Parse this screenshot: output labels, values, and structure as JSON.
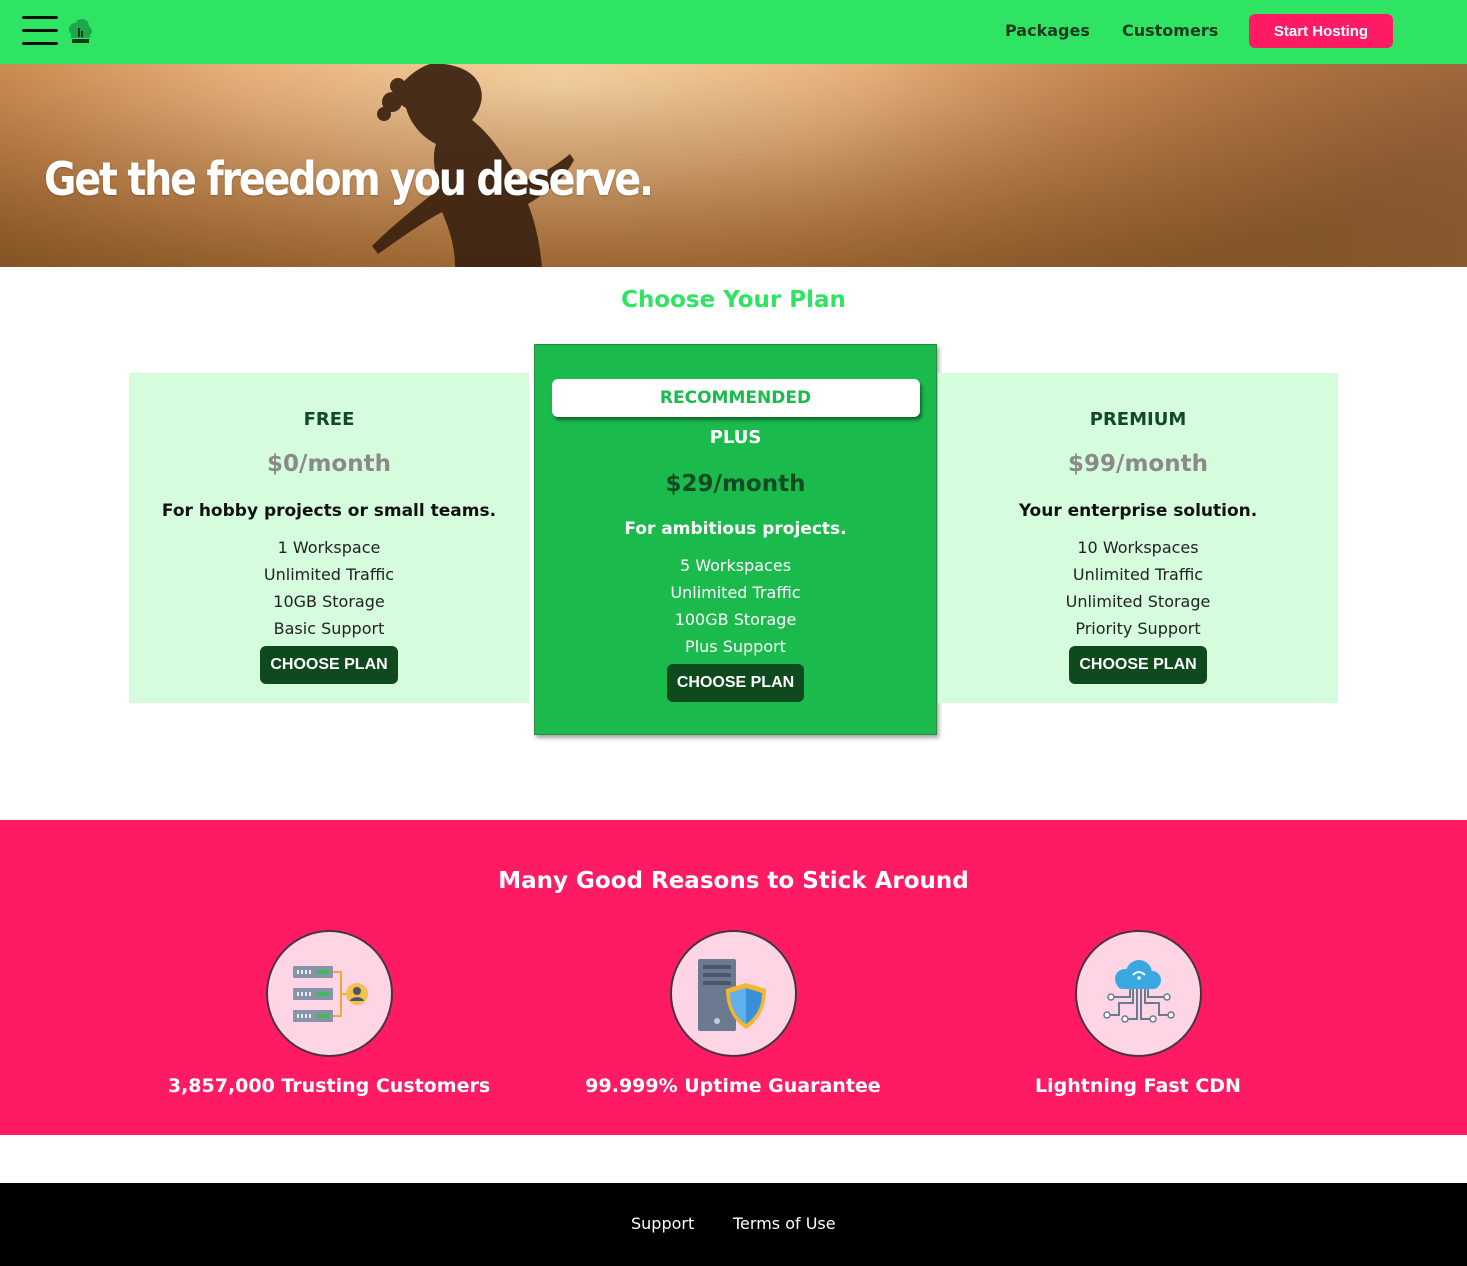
{
  "nav": {
    "menu_icon": "hamburger-menu-icon",
    "logo_icon": "cloud-tree-logo-icon",
    "links": [
      "Packages",
      "Customers"
    ],
    "cta": "Start Hosting",
    "colors": {
      "bar": "#2ee462",
      "cta": "#ff1b64"
    }
  },
  "hero": {
    "title": "Get the freedom you deserve."
  },
  "plans": {
    "title": "Choose Your Plan",
    "free": {
      "name": "FREE",
      "price": "$0/month",
      "tagline": "For hobby projects or small teams.",
      "features": [
        "1 Workspace",
        "Unlimited Traffic",
        "10GB Storage",
        "Basic Support"
      ],
      "button": "CHOOSE PLAN"
    },
    "plus": {
      "badge": "RECOMMENDED",
      "name": "PLUS",
      "price": "$29/month",
      "tagline": "For ambitious projects.",
      "features": [
        "5 Workspaces",
        "Unlimited Traffic",
        "100GB Storage",
        "Plus Support"
      ],
      "button": "CHOOSE PLAN"
    },
    "premium": {
      "name": "PREMIUM",
      "price": "$99/month",
      "tagline": "Your enterprise solution.",
      "features": [
        "10 Workspaces",
        "Unlimited Traffic",
        "Unlimited Storage",
        "Priority Support"
      ],
      "button": "CHOOSE PLAN"
    },
    "colors": {
      "side_card": "#d5fcdc",
      "featured_card": "#1bba4c",
      "button": "#0f4a1f"
    }
  },
  "reasons": {
    "title": "Many Good Reasons to Stick Around",
    "items": [
      {
        "icon": "servers-user-icon",
        "label": "3,857,000 Trusting Customers"
      },
      {
        "icon": "server-shield-icon",
        "label": "99.999% Uptime Guarantee"
      },
      {
        "icon": "cloud-network-icon",
        "label": "Lightning Fast CDN"
      }
    ],
    "color": "#ff1b64"
  },
  "footer": {
    "links": [
      "Support",
      "Terms of Use"
    ]
  }
}
